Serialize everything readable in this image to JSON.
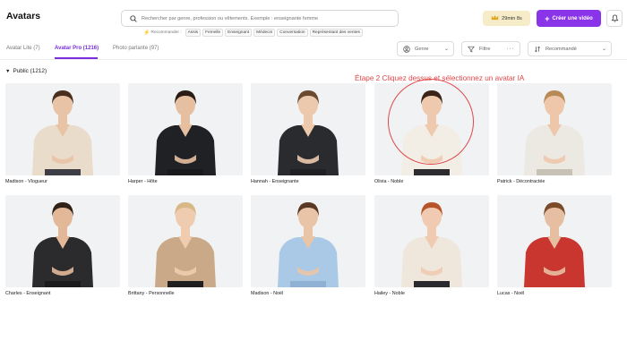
{
  "header": {
    "title": "Avatars",
    "search_placeholder": "Rechercher par genre, profession ou vêtements. Exemple : enseignante femme",
    "credits": "29min 8s",
    "create_label": "Créer une vidéo"
  },
  "suggestions": {
    "label": "Recommander :",
    "chips": [
      "Assis",
      "Femelle",
      "Enseignant",
      "Médecin",
      "Conversation",
      "Représentant des ventes"
    ]
  },
  "tabs": [
    {
      "label": "Avatar Lite (7)",
      "active": false
    },
    {
      "label": "Avatar Pro (1216)",
      "active": true
    },
    {
      "label": "Photo parlante (97)",
      "active": false
    }
  ],
  "filters": {
    "genre": "Genre",
    "filtre": "Filtre",
    "sort": "Recommandé"
  },
  "section": {
    "label": "Public (1212)"
  },
  "annotation": "Étape 2 Cliquez dessus et sélectionnez un avatar IA",
  "avatars": [
    {
      "name": "Madison - Vlogueur",
      "top": "#e9dccb",
      "hair": "#4a2f20",
      "skin": "#e9c3a6",
      "bottom": "#3e3e46"
    },
    {
      "name": "Harper - Hôte",
      "top": "#202124",
      "hair": "#2a1b14",
      "skin": "#e6bea0",
      "bottom": "#1a1a1c"
    },
    {
      "name": "Hannah - Enseignante",
      "top": "#2a2b2f",
      "hair": "#6b4a2f",
      "skin": "#ecc9ad",
      "bottom": "#202022"
    },
    {
      "name": "Olivia - Noble",
      "top": "#f2eee6",
      "hair": "#3a2418",
      "skin": "#efc9ae",
      "bottom": "#2c2c30"
    },
    {
      "name": "Patrick - Décontractée",
      "top": "#ece9e2",
      "hair": "#b88a55",
      "skin": "#eec7ab",
      "bottom": "#c8c2b6"
    },
    {
      "name": "Charles - Enseignant",
      "top": "#2b2a2c",
      "hair": "#2f2218",
      "skin": "#e2b899",
      "bottom": "#1b1b1d"
    },
    {
      "name": "Brittany - Personnelle",
      "top": "#c9a987",
      "hair": "#d8b887",
      "skin": "#efcbb0",
      "bottom": "#1f1f22"
    },
    {
      "name": "Madison - Noël",
      "top": "#a9c9e6",
      "hair": "#5a3826",
      "skin": "#eac4a7",
      "bottom": "#8fb2d4"
    },
    {
      "name": "Hailey - Noble",
      "top": "#efe7dc",
      "hair": "#b8542a",
      "skin": "#f0cbb1",
      "bottom": "#2a2a2e"
    },
    {
      "name": "Lucas - Noël",
      "top": "#c8362f",
      "hair": "#7a4c2a",
      "skin": "#e6bfa2",
      "bottom": "#c8362f"
    }
  ]
}
